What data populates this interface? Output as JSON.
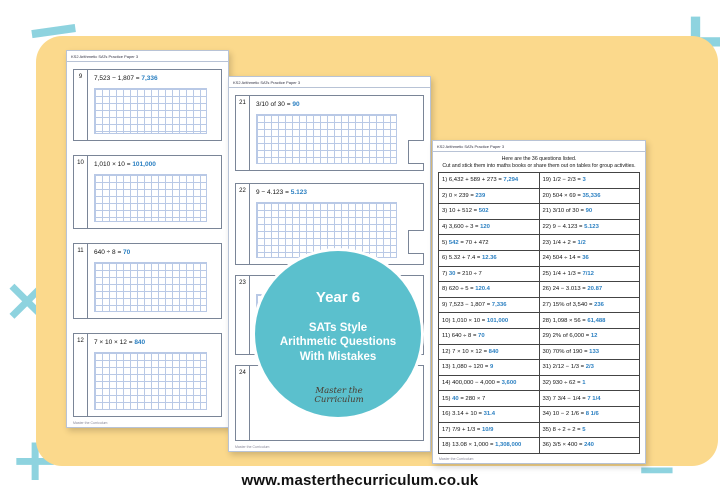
{
  "decor": {
    "plus": "+",
    "minus": "−",
    "times": "×",
    "two": "2"
  },
  "sheets": {
    "left": {
      "header": "KS2 Arithmetic SATs Practice Paper 3",
      "footer": "Master the Curriculum",
      "questions": [
        {
          "num": "9",
          "text": "7,523 − 1,807 = ",
          "answer": "7,336"
        },
        {
          "num": "10",
          "text": "1,010 × 10 = ",
          "answer": "101,000"
        },
        {
          "num": "11",
          "text": "640 ÷ 8 = ",
          "answer": "70"
        },
        {
          "num": "12",
          "text": "7 × 10 × 12 = ",
          "answer": "840"
        }
      ]
    },
    "middle": {
      "header": "KS2 Arithmetic SATs Practice Paper 3",
      "footer": "Master the Curriculum",
      "questions": [
        {
          "num": "21",
          "text": "3/10 of 30 = ",
          "answer": "90"
        },
        {
          "num": "22",
          "text": "9 − 4.123 = ",
          "answer": "5.123"
        },
        {
          "num": "23",
          "text": "",
          "answer": ""
        },
        {
          "num": "24",
          "text": "",
          "answer": ""
        }
      ]
    },
    "right": {
      "header": "KS2 Arithmetic SATs Practice Paper 3",
      "intro1": "Here are the 36 questions listed.",
      "intro2": "Cut and stick them into maths books or share them out on tables for group activities.",
      "footer": "Master the Curriculum",
      "rows": [
        [
          {
            "q": "1) 6,432 + 589 + 273 = ",
            "a": "7,294"
          },
          {
            "q": "19) 1/2 − 2/3 = ",
            "a": "3"
          }
        ],
        [
          {
            "q": "2) 0 × 239 = ",
            "a": "239"
          },
          {
            "q": "20) 504 × 69 = ",
            "a": "35,336"
          }
        ],
        [
          {
            "q": "3) 10 + 512 = ",
            "a": "502"
          },
          {
            "q": "21) 3/10 of 30 = ",
            "a": "90"
          }
        ],
        [
          {
            "q": "4) 3,600 ÷ 3 = ",
            "a": "120"
          },
          {
            "q": "22) 9 − 4.123 = ",
            "a": "5.123"
          }
        ],
        [
          {
            "q": "5) ",
            "a": "542",
            "q2": " = 70 + 472"
          },
          {
            "q": "23) 1/4 + 2 = ",
            "a": "1/2"
          }
        ],
        [
          {
            "q": "6) 5.32 + 7.4 = ",
            "a": "12.36"
          },
          {
            "q": "24) 504 ÷ 14 = ",
            "a": "36"
          }
        ],
        [
          {
            "q": "7) ",
            "a": "30",
            "q2": " = 210 ÷ 7"
          },
          {
            "q": "25) 1/4 + 1/3 = ",
            "a": "7/12"
          }
        ],
        [
          {
            "q": "8) 620 ÷ 5 = ",
            "a": "120.4"
          },
          {
            "q": "26) 24 − 3.013 = ",
            "a": "20.87"
          }
        ],
        [
          {
            "q": "9) 7,523 − 1,807 = ",
            "a": "7,336"
          },
          {
            "q": "27) 15% of 3,540 = ",
            "a": "236"
          }
        ],
        [
          {
            "q": "10) 1,010 × 10 = ",
            "a": "101,000"
          },
          {
            "q": "28) 1,098 × 56 = ",
            "a": "61,488"
          }
        ],
        [
          {
            "q": "11) 640 ÷ 8 = ",
            "a": "70"
          },
          {
            "q": "29) 2% of 6,000 = ",
            "a": "12"
          }
        ],
        [
          {
            "q": "12) 7 × 10 × 12 = ",
            "a": "840"
          },
          {
            "q": "30) 70% of 190 = ",
            "a": "133"
          }
        ],
        [
          {
            "q": "13) 1,080 ÷ 120 = ",
            "a": "9"
          },
          {
            "q": "31) 2/12 − 1/3 = ",
            "a": "2/3"
          }
        ],
        [
          {
            "q": "14) 400,000 − 4,000 = ",
            "a": "3,600"
          },
          {
            "q": "32) 930 ÷ 62 = ",
            "a": "1"
          }
        ],
        [
          {
            "q": "15) ",
            "a": "40",
            "q2": " = 280 × 7"
          },
          {
            "q": "33) 7 3/4 − 1/4 = ",
            "a": "7 1/4"
          }
        ],
        [
          {
            "q": "16) 3.14 + 10 = ",
            "a": "31.4"
          },
          {
            "q": "34) 10 − 2 1/6 = ",
            "a": "8 1/6"
          }
        ],
        [
          {
            "q": "17) 7/9 + 1/3 = ",
            "a": "10/9"
          },
          {
            "q": "35) 8 ÷ 2 ÷ 2 = ",
            "a": "5"
          }
        ],
        [
          {
            "q": "18) 13.08 × 1,000 = ",
            "a": "1,308,000"
          },
          {
            "q": "36) 3/5 × 400 = ",
            "a": "240"
          }
        ]
      ]
    }
  },
  "badge": {
    "year": "Year 6",
    "title_line1": "SATs Style",
    "title_line2": "Arithmetic Questions",
    "title_line3": "With Mistakes",
    "logo_line1": "Master the",
    "logo_line2": "Curriculum"
  },
  "footer": {
    "url": "www.masterthecurriculum.co.uk"
  },
  "colors": {
    "accent": "#2a7fc1",
    "panel": "#fbd98c",
    "badge": "#5bc0cd",
    "decor": "#8ed3df"
  }
}
